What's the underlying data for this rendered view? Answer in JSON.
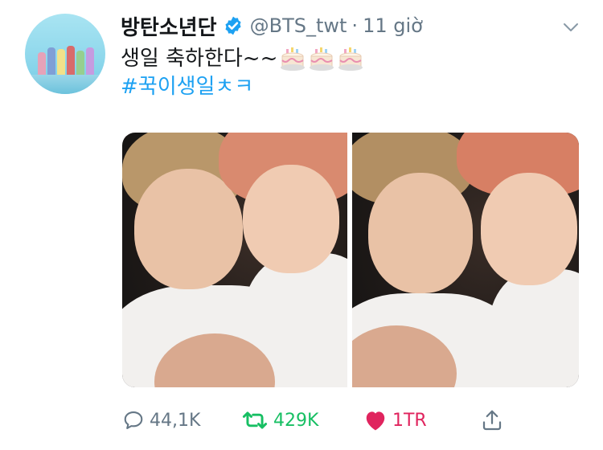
{
  "tweet": {
    "author_name": "방탄소년단",
    "handle": "@BTS_twt",
    "separator": "·",
    "time": "11 giờ",
    "text_line1": "생일 축하한다~~",
    "hashtag": "#꾹이생일ㅊㅋ",
    "emoji": [
      "birthday-cake",
      "birthday-cake",
      "birthday-cake"
    ]
  },
  "actions": {
    "replies": "44,1K",
    "retweets": "429K",
    "likes": "1TR"
  },
  "colors": {
    "link": "#1da1f2",
    "retweet": "#17bf63",
    "like": "#e0245e",
    "muted": "#657786",
    "verified": "#1da1f2"
  },
  "icons": {
    "verified": "verified-badge-icon",
    "menu": "chevron-down-icon",
    "reply": "speech-bubble-icon",
    "retweet": "retweet-arrows-icon",
    "like": "heart-icon",
    "share": "share-upload-icon"
  }
}
